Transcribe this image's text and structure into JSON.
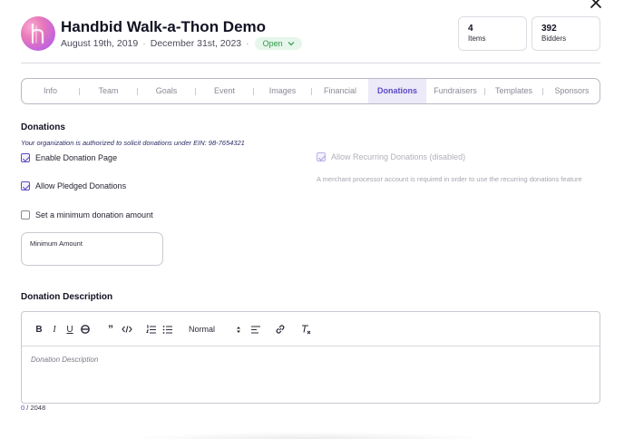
{
  "event": {
    "title": "Handbid Walk-a-Thon Demo",
    "start_date": "August 19th, 2019",
    "end_date": "December 31st, 2023",
    "separator": "·",
    "status": "Open"
  },
  "stats": {
    "items": {
      "count": "4",
      "label": "Items"
    },
    "bidders": {
      "count": "392",
      "label": "Bidders"
    }
  },
  "tabs": [
    {
      "label": "Info",
      "active": false
    },
    {
      "label": "Team",
      "active": false
    },
    {
      "label": "Goals",
      "active": false
    },
    {
      "label": "Event",
      "active": false
    },
    {
      "label": "Images",
      "active": false
    },
    {
      "label": "Financial",
      "active": false
    },
    {
      "label": "Donations",
      "active": true
    },
    {
      "label": "Fundraisers",
      "active": false
    },
    {
      "label": "Templates",
      "active": false
    },
    {
      "label": "Sponsors",
      "active": false
    }
  ],
  "donations": {
    "heading": "Donations",
    "ein_note": "Your organization is authorized to solicit donations under EIN: 98-7654321",
    "enable_page": {
      "label": "Enable Donation Page",
      "checked": true
    },
    "allow_pledged": {
      "label": "Allow Pledged Donations",
      "checked": true
    },
    "min_amount_toggle": {
      "label": "Set a minimum donation amount",
      "checked": false
    },
    "recurring": {
      "label": "Allow Recurring Donations (disabled)",
      "checked": true,
      "disabled": true
    },
    "merchant_note": "A merchant processor account is required in order to use the recurring donations feature",
    "min_amount_field": {
      "label": "Minimum Amount",
      "value": ""
    }
  },
  "description": {
    "heading": "Donation Description",
    "placeholder": "Donation Description",
    "heading_select": "Normal",
    "count_current": "0",
    "count_sep": " / ",
    "count_max": "2048"
  },
  "colors": {
    "accent": "#5b4bc4",
    "active_tab_bg": "#ece9f8",
    "status_green": "#2e9a49",
    "status_bg": "#e6f6ea"
  },
  "icons": [
    "close-icon",
    "handbid-logo",
    "chevron-down-icon",
    "bold-icon",
    "italic-icon",
    "underline-icon",
    "strikethrough-icon",
    "quote-icon",
    "code-icon",
    "ordered-list-icon",
    "bullet-list-icon",
    "select-arrows-icon",
    "align-icon",
    "link-icon",
    "clear-format-icon"
  ]
}
